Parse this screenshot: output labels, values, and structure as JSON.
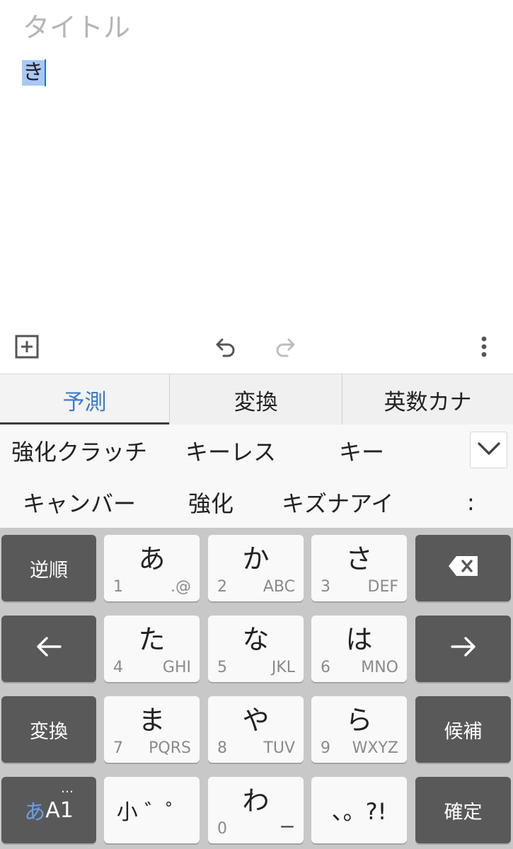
{
  "editor": {
    "title_placeholder": "タイトル",
    "body_selected_text": "き"
  },
  "toolbar": {
    "insert_icon": "plus-square-icon",
    "undo_icon": "undo-icon",
    "redo_icon": "redo-icon",
    "more_icon": "more-vertical-icon"
  },
  "tabs": [
    {
      "label": "予測",
      "active": true
    },
    {
      "label": "変換",
      "active": false
    },
    {
      "label": "英数カナ",
      "active": false
    }
  ],
  "candidates": {
    "row1": [
      "強化クラッチ",
      "キーレス",
      "キー"
    ],
    "row2": [
      "キャンバー",
      "強化",
      "キズナアイ"
    ],
    "row2_more": ":",
    "expand_icon": "chevron-down-icon"
  },
  "keyboard": {
    "reverse_label": "逆順",
    "delete_icon": "backspace-icon",
    "left_icon": "arrow-left-icon",
    "right_icon": "arrow-right-icon",
    "convert_label": "変換",
    "candidates_label": "候補",
    "confirm_label": "確定",
    "mode": {
      "kana": "あ",
      "alnum": "A1",
      "dots": "…"
    },
    "keys": [
      {
        "kana": "あ",
        "num": "1",
        "alpha": ".@"
      },
      {
        "kana": "か",
        "num": "2",
        "alpha": "ABC"
      },
      {
        "kana": "さ",
        "num": "3",
        "alpha": "DEF"
      },
      {
        "kana": "た",
        "num": "4",
        "alpha": "GHI"
      },
      {
        "kana": "な",
        "num": "5",
        "alpha": "JKL"
      },
      {
        "kana": "は",
        "num": "6",
        "alpha": "MNO"
      },
      {
        "kana": "ま",
        "num": "7",
        "alpha": "PQRS"
      },
      {
        "kana": "や",
        "num": "8",
        "alpha": "TUV"
      },
      {
        "kana": "ら",
        "num": "9",
        "alpha": "WXYZ"
      }
    ],
    "small_key": "小 ゛゜",
    "wa_key": {
      "kana": "わ",
      "num": "0",
      "alpha": "ー"
    },
    "punct_key": "、。?!",
    "colors": {
      "dark_key": "#595959",
      "light_key": "#f9f9f9",
      "accent": "#3a7bd5",
      "background": "#c8c8c8"
    }
  }
}
